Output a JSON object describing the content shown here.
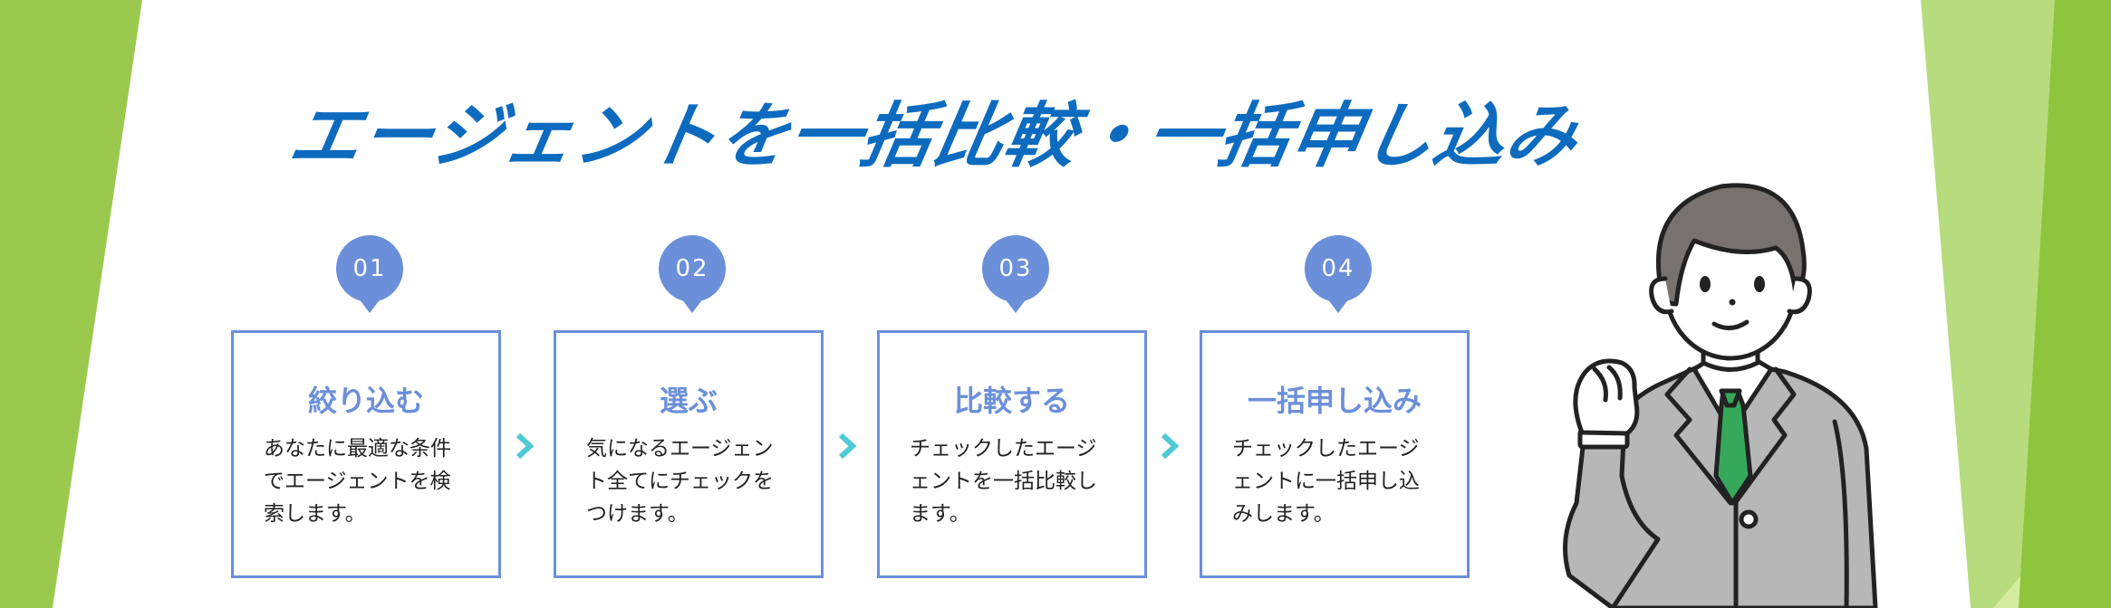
{
  "title": "エージェントを一括比較・一括申し込み",
  "steps": [
    {
      "number": "01",
      "title": "絞り込む",
      "lines": [
        "あなたに最適な条件",
        "でエージェントを検",
        "索します。"
      ]
    },
    {
      "number": "02",
      "title": "選ぶ",
      "lines": [
        "気になるエージェン",
        "ト全てにチェックを",
        "つけます。"
      ]
    },
    {
      "number": "03",
      "title": "比較する",
      "lines": [
        "チェックしたエージ",
        "ェントを一括比較し",
        "ます。"
      ]
    },
    {
      "number": "04",
      "title": "一括申し込み",
      "lines": [
        "チェックしたエージ",
        "ェントに一括申し込",
        "みします。"
      ]
    }
  ],
  "colors": {
    "title": "#0d6bbf",
    "accent": "#6b8fd9",
    "arrow": "#4fc9d6",
    "green_dark": "#9bc94e",
    "green_light": "#c5e59a"
  },
  "icons": {
    "arrow": "chevron-right-icon",
    "person": "businessman-illustration"
  }
}
